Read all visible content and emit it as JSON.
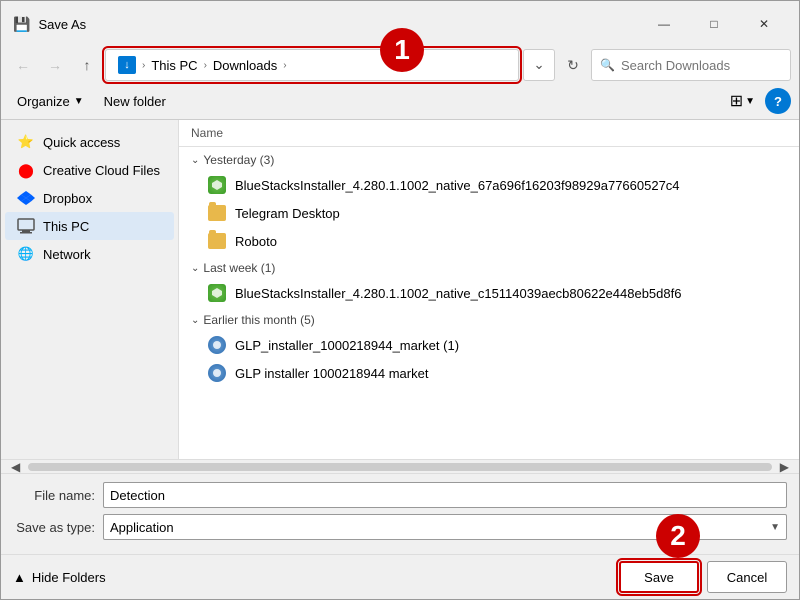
{
  "title_bar": {
    "title": "Save As",
    "window_icon": "💾",
    "buttons": {
      "minimize": "—",
      "maximize": "□",
      "close": "✕"
    }
  },
  "address_bar": {
    "breadcrumbs": [
      {
        "label": "This PC",
        "icon": "down-arrow"
      },
      {
        "label": "Downloads"
      }
    ],
    "dropdown_arrow": "▾",
    "refresh": "↺",
    "search_placeholder": "Search Downloads"
  },
  "toolbar": {
    "organize_label": "Organize",
    "new_folder_label": "New folder",
    "view_icon": "▦",
    "help_label": "?"
  },
  "sidebar": {
    "items": [
      {
        "label": "Quick access",
        "icon": "⭐"
      },
      {
        "label": "Creative Cloud Files",
        "icon": "☁"
      },
      {
        "label": "Dropbox",
        "icon": "📦"
      },
      {
        "label": "This PC",
        "icon": "🖥"
      },
      {
        "label": "Network",
        "icon": "🌐"
      }
    ]
  },
  "file_list": {
    "header": "Name",
    "groups": [
      {
        "label": "Yesterday (3)",
        "collapsed": false,
        "files": [
          {
            "name": "BlueStacksInstaller_4.280.1.1002_native_67a696f16203f98929a77660527c4",
            "type": "bluestacks"
          },
          {
            "name": "Telegram Desktop",
            "type": "folder"
          },
          {
            "name": "Roboto",
            "type": "folder"
          }
        ]
      },
      {
        "label": "Last week (1)",
        "collapsed": false,
        "files": [
          {
            "name": "BlueStacksInstaller_4.280.1.1002_native_c15114039aecb80622e448eb5d8f6",
            "type": "bluestacks"
          }
        ]
      },
      {
        "label": "Earlier this month (5)",
        "collapsed": false,
        "files": [
          {
            "name": "GLP_installer_1000218944_market (1)",
            "type": "glp"
          },
          {
            "name": "GLP installer 1000218944 market",
            "type": "glp"
          }
        ]
      }
    ]
  },
  "bottom_form": {
    "file_name_label": "File name:",
    "file_name_value": "Detection",
    "save_type_label": "Save as type:",
    "save_type_value": "Application"
  },
  "bottom_actions": {
    "hide_folders_label": "Hide Folders",
    "hide_folders_icon": "▲",
    "save_label": "Save",
    "cancel_label": "Cancel"
  }
}
